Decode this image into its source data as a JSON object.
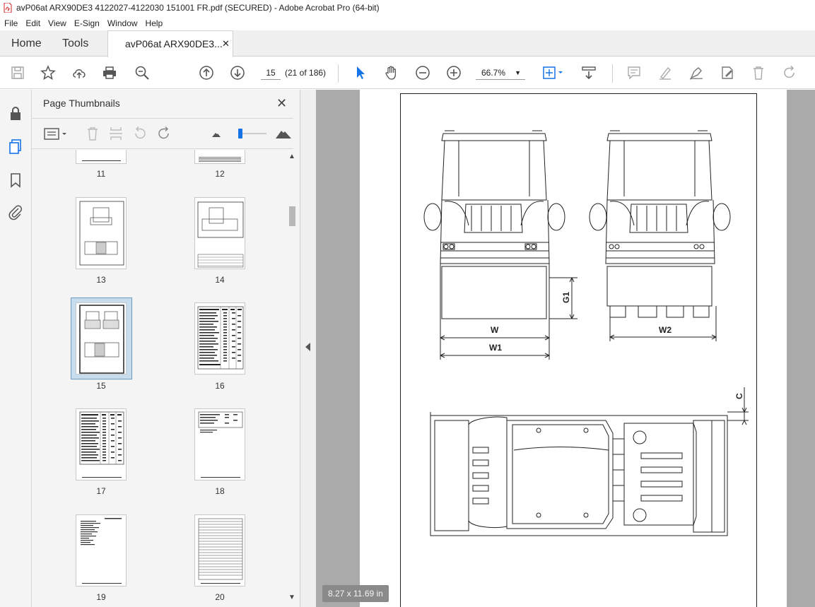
{
  "window": {
    "title": "avP06at ARX90DE3 4122027-4122030 151001 FR.pdf (SECURED) - Adobe Acrobat Pro (64-bit)"
  },
  "menu": [
    "File",
    "Edit",
    "View",
    "E-Sign",
    "Window",
    "Help"
  ],
  "tabs": {
    "home": "Home",
    "tools": "Tools",
    "document": "avP06at ARX90DE3...",
    "close": "✕"
  },
  "toolbar": {
    "page_number": "15",
    "page_count": "(21 of 186)",
    "zoom": "66.7%"
  },
  "panel": {
    "title": "Page Thumbnails",
    "close": "✕"
  },
  "thumbnails": [
    {
      "label": "11"
    },
    {
      "label": "12"
    },
    {
      "label": "13"
    },
    {
      "label": "14"
    },
    {
      "label": "15",
      "selected": true
    },
    {
      "label": "16"
    },
    {
      "label": "17"
    },
    {
      "label": "18"
    },
    {
      "label": "19"
    },
    {
      "label": "20"
    }
  ],
  "drawing": {
    "labels": {
      "w": "W",
      "w1": "W1",
      "w2": "W2",
      "g1": "G1",
      "c": "C"
    }
  },
  "page_size": "8.27 x 11.69 in",
  "colors": {
    "accent": "#1473e6",
    "pdf_red": "#d22020",
    "doc_bg": "#aaaaaa"
  }
}
